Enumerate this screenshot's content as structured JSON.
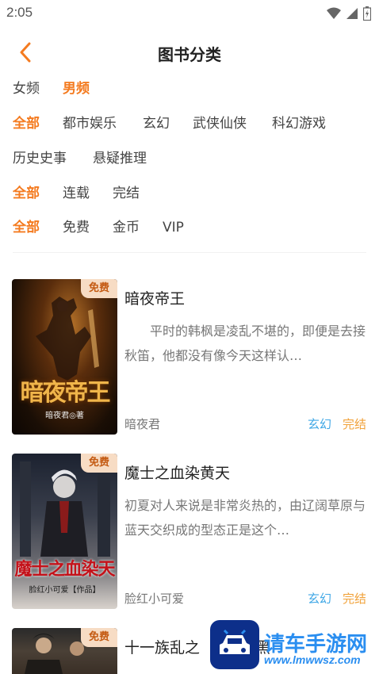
{
  "status_bar": {
    "time": "2:05",
    "icons": [
      "wifi-icon",
      "signal-icon",
      "battery-icon"
    ]
  },
  "nav": {
    "title": "图书分类",
    "back_icon": "chevron-left-icon"
  },
  "filters": {
    "gender": [
      "女频",
      "男频"
    ],
    "gender_active": "男频",
    "category": [
      "全部",
      "都市娱乐",
      "玄幻",
      "武侠仙侠",
      "科幻游戏",
      "历史史事",
      "悬疑推理"
    ],
    "category_active": "全部",
    "status": [
      "全部",
      "连载",
      "完结"
    ],
    "status_active": "全部",
    "price": [
      "全部",
      "免费",
      "金币",
      "VIP"
    ],
    "price_active": "全部"
  },
  "books": [
    {
      "badge": "免费",
      "cover_title": "暗夜帝王",
      "cover_author": "暗夜君◎著",
      "title": "暗夜帝王",
      "description": "平时的韩枫是凌乱不堪的，即便是去接秋笛，他都没有像今天这样认…",
      "author": "暗夜君",
      "genre": "玄幻",
      "status": "完结"
    },
    {
      "badge": "免费",
      "cover_title": "魔士之血染天",
      "cover_author": "脸红小可爱【作品】",
      "title": "魔士之血染黄天",
      "description": "初夏对人来说是非常炎热的，由辽阔草原与蓝天交织成的型态正是这个…",
      "author": "脸红小可爱",
      "genre": "玄幻",
      "status": "完结"
    },
    {
      "badge": "免费",
      "title": "十一族乱之",
      "title_tail": "黑"
    }
  ],
  "watermark": {
    "name": "请车手游网",
    "url": "www.lmwwsz.com"
  },
  "colors": {
    "accent": "#f47b20",
    "genre": "#3fa7e6",
    "status": "#f1a23a",
    "badge_bg": "#f7dcc4"
  }
}
